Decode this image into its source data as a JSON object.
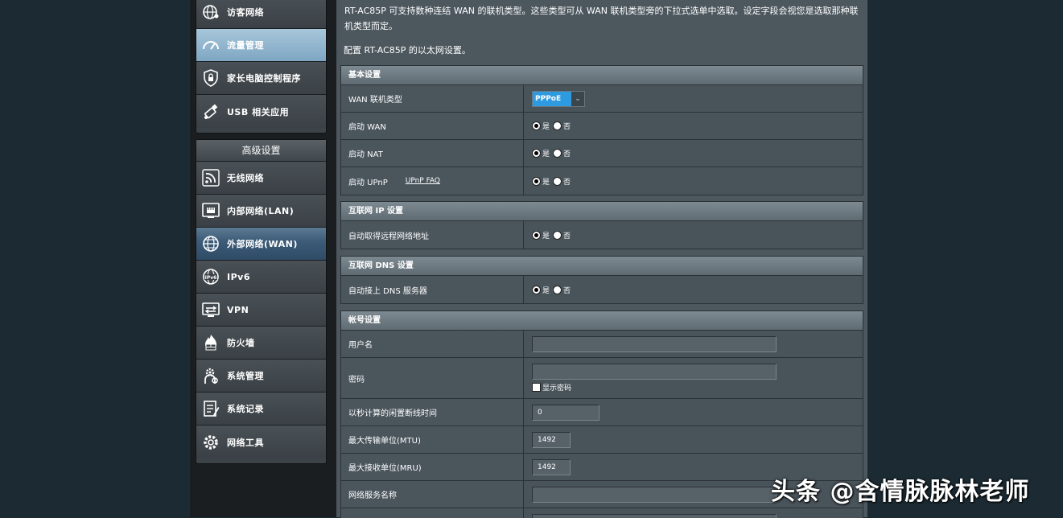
{
  "sidebar": {
    "general_items": [
      {
        "label": "访客网络",
        "icon": "globe-users-icon"
      },
      {
        "label": "流量管理",
        "icon": "gauge-icon",
        "active": true
      },
      {
        "label": "家长电脑控制程序",
        "icon": "parental-shield-icon"
      },
      {
        "label": "USB 相关应用",
        "icon": "usb-icon"
      }
    ],
    "advanced_header": "高级设置",
    "advanced_items": [
      {
        "label": "无线网络",
        "icon": "wifi-icon"
      },
      {
        "label": "内部网络(LAN)",
        "icon": "lan-icon"
      },
      {
        "label": "外部网络(WAN)",
        "icon": "globe-icon",
        "active": true
      },
      {
        "label": "IPv6",
        "icon": "ipv6-icon"
      },
      {
        "label": "VPN",
        "icon": "vpn-icon"
      },
      {
        "label": "防火墙",
        "icon": "firewall-icon"
      },
      {
        "label": "系统管理",
        "icon": "admin-gear-icon"
      },
      {
        "label": "系统记录",
        "icon": "log-icon"
      },
      {
        "label": "网络工具",
        "icon": "tools-gear-icon"
      }
    ]
  },
  "main": {
    "intro": "RT-AC85P 可支持数种连结 WAN 的联机类型。这些类型可从 WAN 联机类型旁的下拉式选单中选取。设定字段会视您是选取那种联机类型而定。",
    "intro2": "配置 RT-AC85P 的以太网设置。",
    "basic": {
      "title": "基本设置",
      "wan_type_label": "WAN 联机类型",
      "wan_type_value": "PPPoE",
      "enable_wan_label": "启动 WAN",
      "enable_nat_label": "启动 NAT",
      "enable_upnp_label": "启动 UPnP",
      "upnp_faq": "UPnP  FAQ"
    },
    "ip": {
      "title": "互联网 IP 设置",
      "auto_ip_label": "自动取得远程网络地址"
    },
    "dns": {
      "title": "互联网 DNS 设置",
      "auto_dns_label": "自动接上 DNS 服务器"
    },
    "account": {
      "title": "帐号设置",
      "username_label": "用户名",
      "username_value": "",
      "password_label": "密码",
      "password_value": "",
      "show_password_label": "显示密码",
      "idle_label": "以秒计算的闲置断线时间",
      "idle_value": "0",
      "mtu_label": "最大传输单位(MTU)",
      "mtu_value": "1492",
      "mru_label": "最大接收单位(MRU)",
      "mru_value": "1492",
      "service_label": "网络服务名称",
      "service_value": ""
    },
    "yes": "是",
    "no": "否"
  },
  "watermark": "头条 @含情脉脉林老师"
}
